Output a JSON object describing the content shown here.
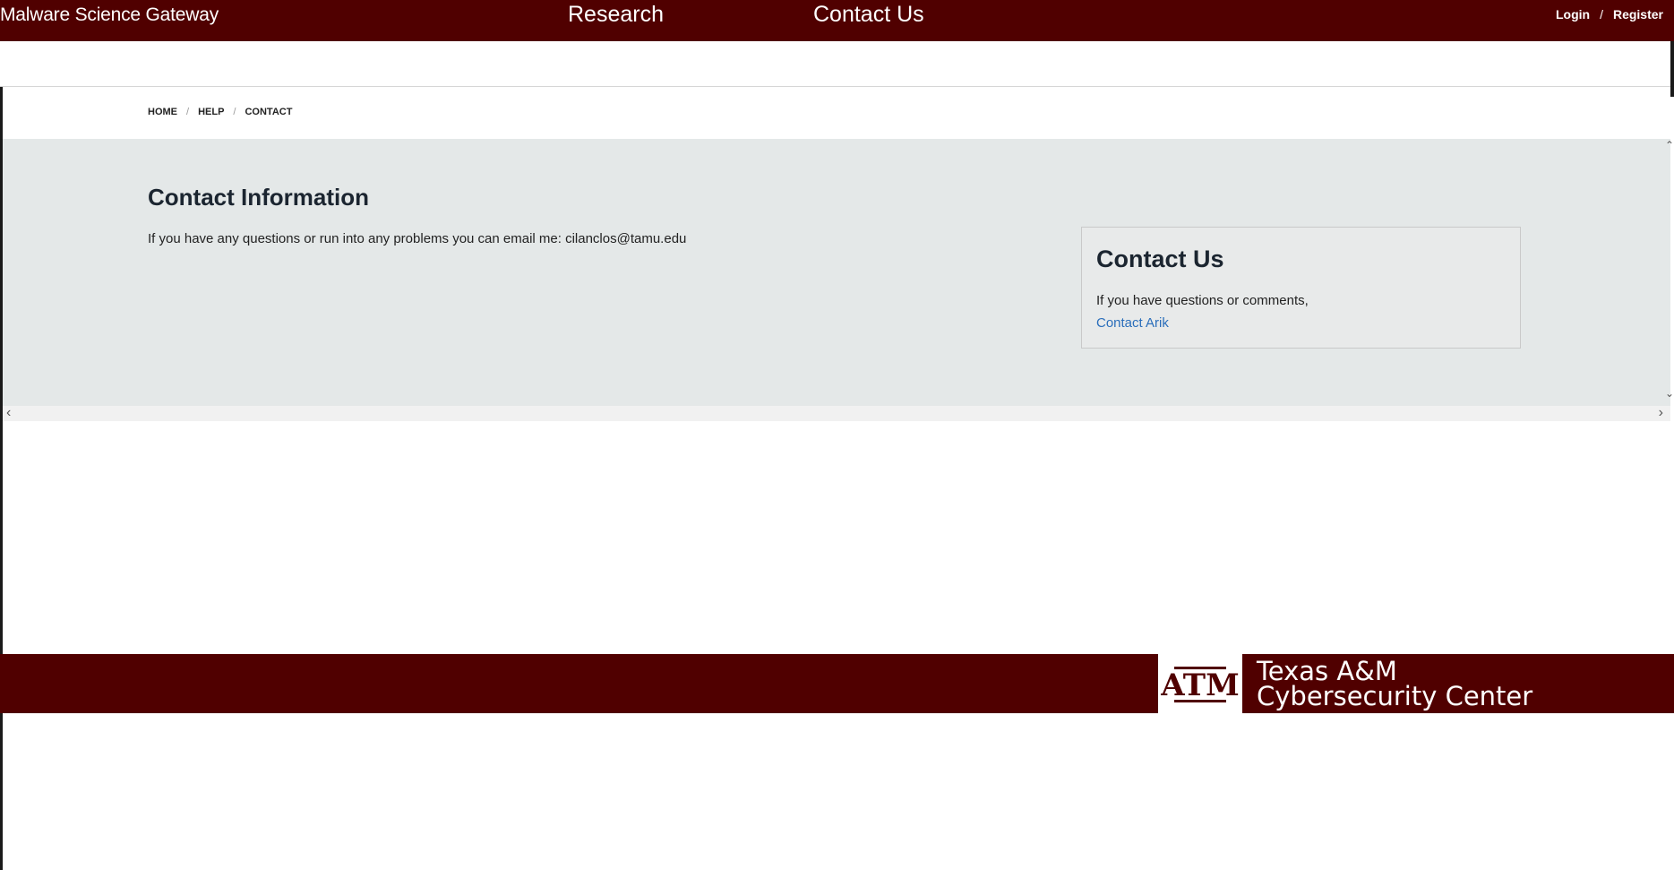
{
  "header": {
    "brand": "Malware Science Gateway",
    "nav": [
      "Research",
      "Contact Us"
    ],
    "login": "Login",
    "separator": "/",
    "register": "Register"
  },
  "breadcrumb": {
    "items": [
      "HOME",
      "HELP",
      "CONTACT"
    ],
    "separator": "/"
  },
  "main": {
    "title": "Contact Information",
    "text": "If you have any questions or run into any problems you can email me: cilanclos@tamu.edu"
  },
  "sidebar_card": {
    "title": "Contact Us",
    "text": "If you have questions or comments,",
    "link": "Contact Arik"
  },
  "footer": {
    "logo_mark": "ATM",
    "line1": "Texas A&M",
    "line2": "Cybersecurity Center"
  },
  "colors": {
    "maroon": "#500000",
    "content_bg": "#e4e8e8",
    "link": "#2a6ebb"
  },
  "icons": [
    "scroll-left-icon",
    "scroll-right-icon",
    "scroll-up-icon",
    "scroll-down-icon",
    "atm-logo-icon"
  ]
}
